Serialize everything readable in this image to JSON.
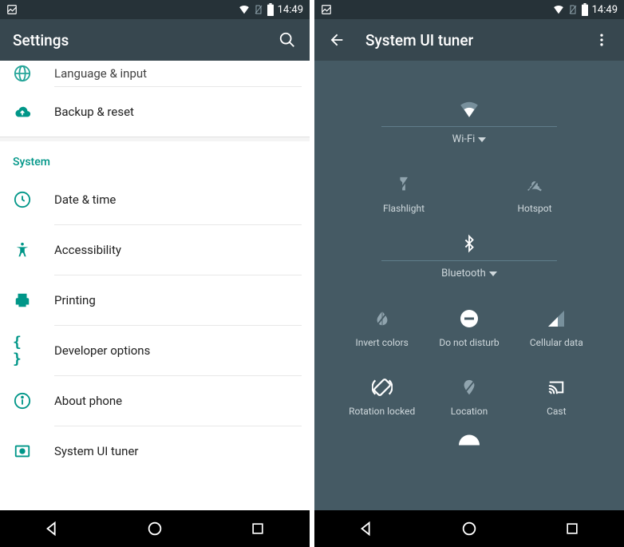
{
  "status": {
    "time": "14:49"
  },
  "left": {
    "title": "Settings",
    "partial_top": "Language & input",
    "rows": [
      {
        "icon": "backup",
        "label": "Backup & reset"
      }
    ],
    "section": "System",
    "system_rows": [
      {
        "icon": "clock",
        "label": "Date & time"
      },
      {
        "icon": "accessibility",
        "label": "Accessibility"
      },
      {
        "icon": "print",
        "label": "Printing"
      },
      {
        "icon": "braces",
        "label": "Developer options"
      },
      {
        "icon": "info",
        "label": "About phone"
      },
      {
        "icon": "tuner",
        "label": "System UI tuner"
      }
    ]
  },
  "right": {
    "title": "System UI tuner",
    "tiles": {
      "wifi": "Wi-Fi",
      "flashlight": "Flashlight",
      "hotspot": "Hotspot",
      "bluetooth": "Bluetooth",
      "invert": "Invert colors",
      "dnd": "Do not disturb",
      "cellular": "Cellular data",
      "rotation": "Rotation locked",
      "location": "Location",
      "cast": "Cast"
    }
  }
}
